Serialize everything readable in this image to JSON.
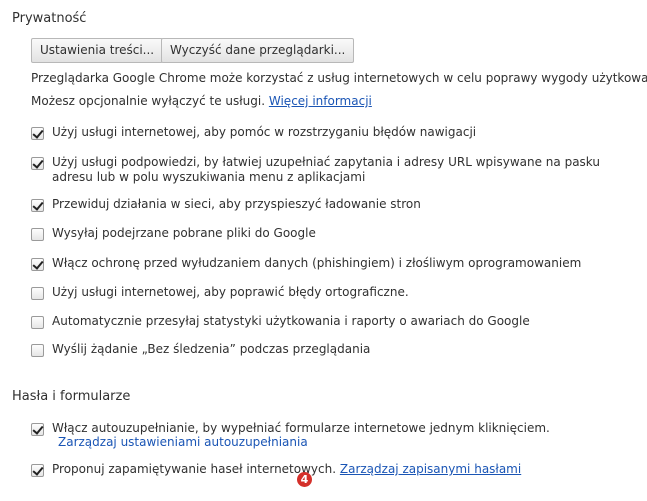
{
  "privacy": {
    "title": "Prywatność",
    "content_settings_button": "Ustawienia treści...",
    "clear_data_button": "Wyczyść dane przeglądarki...",
    "intro_line1": "Przeglądarka Google Chrome może korzystać z usług internetowych w celu poprawy wygody użytkowania.",
    "intro_line2_text": "Możesz opcjonalnie wyłączyć te usługi.",
    "intro_link": "Więcej informacji",
    "options": [
      {
        "label": "Użyj usługi internetowej, aby pomóc w rozstrzyganiu błędów nawigacji",
        "checked": true
      },
      {
        "label": "Użyj usługi podpowiedzi, by łatwiej uzupełniać zapytania i adresy URL wpisywane na pasku adresu lub w polu wyszukiwania menu z aplikacjami",
        "checked": true
      },
      {
        "label": "Przewiduj działania w sieci, aby przyspieszyć ładowanie stron",
        "checked": true
      },
      {
        "label": "Wysyłaj podejrzane pobrane pliki do Google",
        "checked": false
      },
      {
        "label": "Włącz ochronę przed wyłudzaniem danych (phishingiem) i złośliwym oprogramowaniem",
        "checked": true
      },
      {
        "label": "Użyj usługi internetowej, aby poprawić błędy ortograficzne.",
        "checked": false
      },
      {
        "label": "Automatycznie przesyłaj statystyki użytkowania i raporty o awariach do Google",
        "checked": false
      },
      {
        "label": "Wyślij żądanie „Bez śledzenia” podczas przeglądania",
        "checked": false
      }
    ]
  },
  "passwords": {
    "title": "Hasła i formularze",
    "autofill_label": "Włącz autouzupełnianie, by wypełniać formularze internetowe jednym kliknięciem.",
    "autofill_checked": true,
    "autofill_link": "Zarządzaj ustawieniami autouzupełniania",
    "save_passwords_label": "Proponuj zapamiętywanie haseł internetowych.",
    "save_passwords_checked": true,
    "passwords_link": "Zarządzaj zapisanymi hasłami",
    "badge_number": "4",
    "badge_color": "#d4302a"
  },
  "colors": {
    "link": "#1a55b5",
    "text": "#303030"
  }
}
